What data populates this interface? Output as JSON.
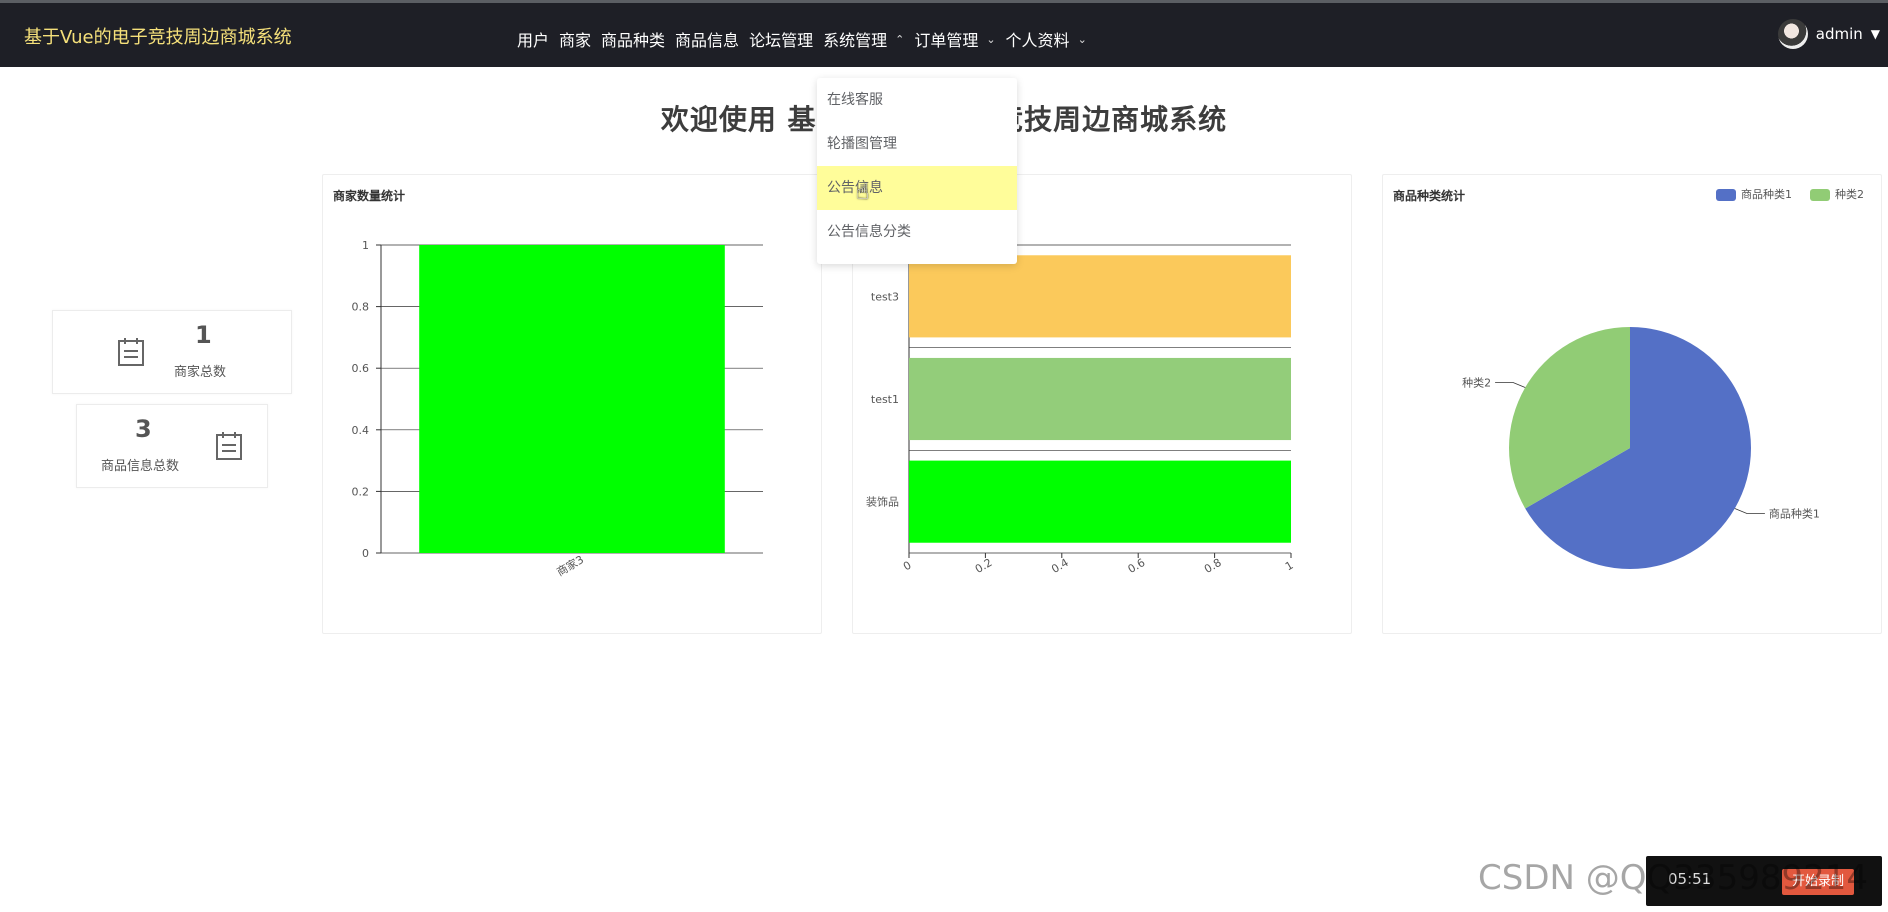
{
  "app": {
    "title": "基于Vue的电子竞技周边商城系统"
  },
  "nav": {
    "items": [
      {
        "label": "用户"
      },
      {
        "label": "商家"
      },
      {
        "label": "商品种类"
      },
      {
        "label": "商品信息"
      },
      {
        "label": "论坛管理"
      },
      {
        "label": "系统管理",
        "chevron": "up"
      },
      {
        "label": "订单管理",
        "chevron": "down"
      },
      {
        "label": "个人资料",
        "chevron": "down"
      }
    ],
    "user": {
      "name": "admin"
    }
  },
  "dropdown": {
    "items": [
      {
        "label": "在线客服"
      },
      {
        "label": "轮播图管理"
      },
      {
        "label": "公告信息",
        "active": true
      },
      {
        "label": "公告信息分类"
      }
    ]
  },
  "welcome": {
    "text": "欢迎使用 基于Vue的电子竞技周边商城系统"
  },
  "stats": [
    {
      "value": "1",
      "label": "商家总数",
      "icon": "calendar-icon"
    },
    {
      "value": "3",
      "label": "商品信息总数",
      "icon": "calendar-icon"
    }
  ],
  "cards": {
    "merchant": {
      "title": "商家数量统计"
    },
    "category": {
      "title": "商品种类统计"
    }
  },
  "chart_data": [
    {
      "type": "bar",
      "title": "商家数量统计",
      "categories": [
        "商家3"
      ],
      "values": [
        1
      ],
      "ylim": [
        0,
        1
      ],
      "yticks": [
        "0",
        "0.2",
        "0.4",
        "0.6",
        "0.8",
        "1"
      ],
      "colors": [
        "#00ff00"
      ],
      "grid": true
    },
    {
      "type": "bar",
      "orientation": "horizontal",
      "title": "",
      "categories": [
        "装饰品",
        "test1",
        "test3"
      ],
      "values": [
        1,
        1,
        1
      ],
      "xlim": [
        0,
        1
      ],
      "xticks": [
        "0",
        "0.2",
        "0.4",
        "0.6",
        "0.8",
        "1"
      ],
      "colors": [
        "#00ff00",
        "#93cd7a",
        "#fbc95b"
      ]
    },
    {
      "type": "pie",
      "title": "商品种类统计",
      "legend_position": "top-right",
      "slices": [
        {
          "label": "商品种类1",
          "value": 2,
          "color": "#5470c6"
        },
        {
          "label": "种类2",
          "value": 1,
          "color": "#91cc75"
        }
      ]
    }
  ],
  "watermark": {
    "text": "CSDN @QQ335989214"
  },
  "recorder": {
    "time": "05:51",
    "button": "开始录制"
  },
  "colors": {
    "navbar": "#1e1f26",
    "brand": "#f5e07a",
    "menu_active": "#fffd9a"
  }
}
